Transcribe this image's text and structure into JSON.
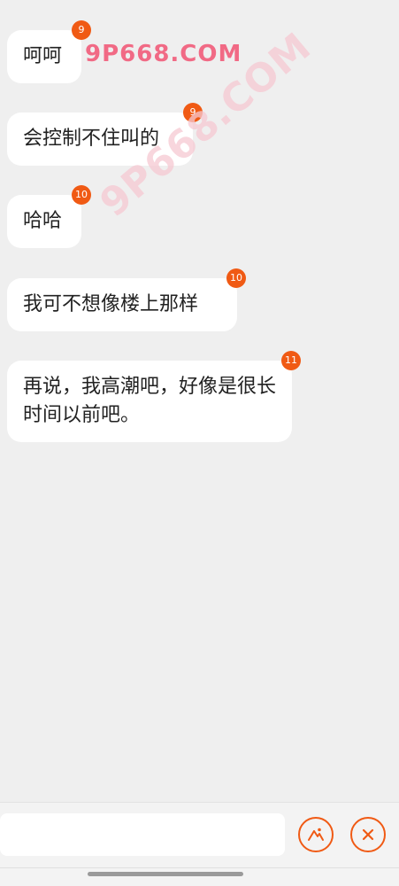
{
  "messages": [
    {
      "text": "呵呵",
      "count": "9"
    },
    {
      "text": "会控制不住叫的",
      "count": "9"
    },
    {
      "text": "哈哈",
      "count": "10"
    },
    {
      "text": "我可不想像楼上那样",
      "count": "10"
    },
    {
      "text": "再说，我高潮吧，好像是很长时间以前吧。",
      "count": "11"
    }
  ],
  "watermarks": {
    "primary": "9P668.COM",
    "diagonal": "9P668.COM"
  },
  "composer": {
    "value": "",
    "placeholder": ""
  },
  "icons": {
    "image_button": "image-icon",
    "close_button": "close-icon"
  },
  "colors": {
    "accent": "#f05a14",
    "background": "#efefef",
    "bubble": "#ffffff"
  }
}
